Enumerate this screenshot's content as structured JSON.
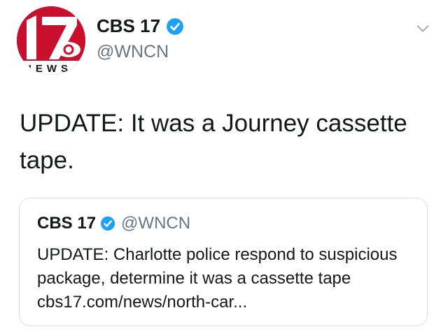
{
  "tweet": {
    "author": {
      "display_name": "CBS 17",
      "handle": "@WNCN",
      "avatar_logo_text": "17",
      "avatar_news_text": "NEWS"
    },
    "text": "UPDATE: It was a Journey cassette tape.",
    "quoted": {
      "display_name": "CBS 17",
      "handle": "@WNCN",
      "text": "UPDATE: Charlotte police respond to suspicious package, determine it was a cassette tape cbs17.com/news/north-car..."
    }
  },
  "icons": {
    "verified": "verified-badge-icon",
    "menu": "chevron-down-icon"
  },
  "colors": {
    "brand_red": "#c8102e",
    "verified_blue": "#1da1f2",
    "secondary_text": "#657786",
    "border": "#d9dfe4"
  }
}
